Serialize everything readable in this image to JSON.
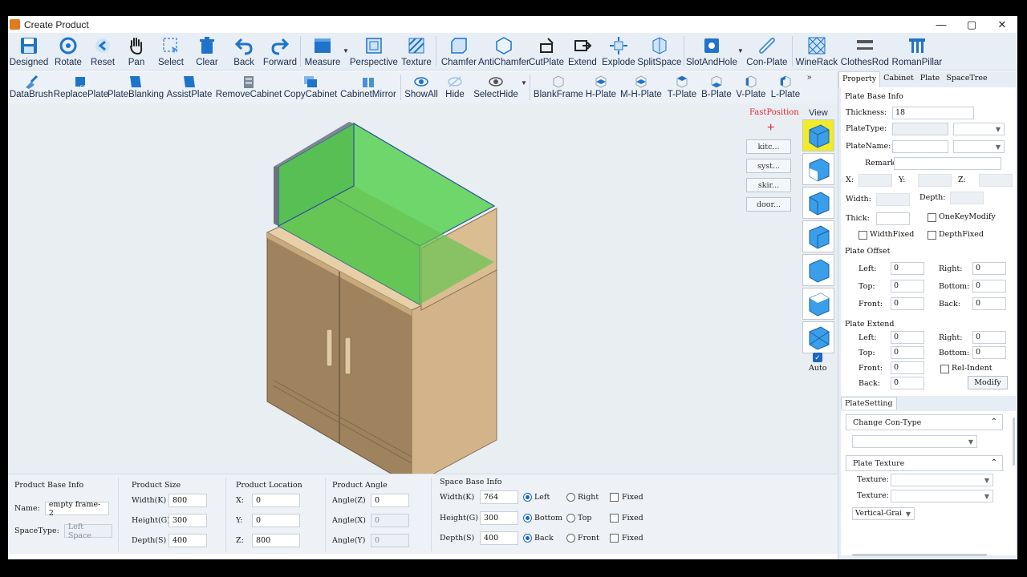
{
  "window": {
    "title": "Create Product",
    "controls": [
      "—",
      "▢",
      "✕"
    ]
  },
  "toolbar1": [
    {
      "label": "Designed",
      "icon": "save-icon"
    },
    {
      "label": "Rotate",
      "icon": "rotate-icon"
    },
    {
      "label": "Reset",
      "icon": "reset-icon"
    },
    {
      "label": "Pan",
      "icon": "hand-icon"
    },
    {
      "label": "Select",
      "icon": "select-icon"
    },
    {
      "label": "Clear",
      "icon": "trash-icon"
    },
    {
      "label": "Back",
      "icon": "undo-icon"
    },
    {
      "label": "Forward",
      "icon": "redo-icon"
    },
    {
      "label": "Measure",
      "icon": "measure-icon"
    },
    {
      "label": "Perspective",
      "icon": "perspective-icon"
    },
    {
      "label": "Texture",
      "icon": "texture-icon"
    },
    {
      "label": "Chamfer",
      "icon": "chamfer-icon"
    },
    {
      "label": "AntiChamfer",
      "icon": "antichamfer-icon"
    },
    {
      "label": "CutPlate",
      "icon": "cutplate-icon"
    },
    {
      "label": "Extend",
      "icon": "extend-icon"
    },
    {
      "label": "Explode",
      "icon": "explode-icon"
    },
    {
      "label": "SplitSpace",
      "icon": "splitspace-icon"
    },
    {
      "label": "SlotAndHole",
      "icon": "slot-icon"
    },
    {
      "label": "Con-Plate",
      "icon": "link-icon"
    },
    {
      "label": "WineRack",
      "icon": "winerack-icon"
    },
    {
      "label": "ClothesRod",
      "icon": "clothesrod-icon"
    },
    {
      "label": "RomanPillar",
      "icon": "pillar-icon"
    }
  ],
  "toolbar2": [
    {
      "label": "DataBrush",
      "icon": "brush-icon"
    },
    {
      "label": "ReplacePlate",
      "icon": "replace-icon"
    },
    {
      "label": "PlateBlanking",
      "icon": "plate-icon"
    },
    {
      "label": "AssistPlate",
      "icon": "plate-icon"
    },
    {
      "label": "RemoveCabinet",
      "icon": "cabinet-icon"
    },
    {
      "label": "CopyCabinet",
      "icon": "copy-icon"
    },
    {
      "label": "CabinetMirror",
      "icon": "mirror-icon"
    },
    {
      "label": "ShowAll",
      "icon": "eye-icon"
    },
    {
      "label": "Hide",
      "icon": "eye-hide-icon"
    },
    {
      "label": "SelectHide",
      "icon": "eye-select-icon"
    },
    {
      "label": "BlankFrame",
      "icon": "frame-icon"
    },
    {
      "label": "H-Plate",
      "icon": "hplate-icon"
    },
    {
      "label": "M-H-Plate",
      "icon": "mhplate-icon"
    },
    {
      "label": "T-Plate",
      "icon": "tplate-icon"
    },
    {
      "label": "B-Plate",
      "icon": "bplate-icon"
    },
    {
      "label": "V-Plate",
      "icon": "vplate-icon"
    },
    {
      "label": "L-Plate",
      "icon": "lplate-icon"
    }
  ],
  "viewport": {
    "fast_position": "FastPosition",
    "view_label": "View",
    "side_buttons": [
      "kitc...",
      "syst...",
      "skir...",
      "door..."
    ],
    "auto_label": "Auto"
  },
  "bottom": {
    "product_base": {
      "title": "Product Base Info",
      "name_label": "Name:",
      "name_value": "empty frame-2",
      "spacetype_label": "SpaceType:",
      "spacetype_value": "Left Space"
    },
    "product_size": {
      "title": "Product Size",
      "width_label": "Width(K)",
      "width_value": "800",
      "height_label": "Height(G)",
      "height_value": "300",
      "depth_label": "Depth(S)",
      "depth_value": "400"
    },
    "product_location": {
      "title": "Product Location",
      "x_label": "X:",
      "x_value": "0",
      "y_label": "Y:",
      "y_value": "0",
      "z_label": "Z:",
      "z_value": "800"
    },
    "product_angle": {
      "title": "Product Angle",
      "az_label": "Angle(Z)",
      "az_value": "0",
      "ax_label": "Angle(X)",
      "ax_value": "0",
      "ay_label": "Angle(Y)",
      "ay_value": "0"
    },
    "space_base": {
      "title": "Space Base Info",
      "width_label": "Width(K)",
      "width_value": "764",
      "height_label": "Height(G)",
      "height_value": "300",
      "depth_label": "Depth(S)",
      "depth_value": "400",
      "r1a": "Left",
      "r1b": "Right",
      "r2a": "Bottom",
      "r2b": "Top",
      "r3a": "Back",
      "r3b": "Front",
      "fixed": "Fixed"
    }
  },
  "rpanel": {
    "tabs": [
      "Property",
      "Cabinet",
      "Plate",
      "SpaceTree"
    ],
    "plate_base_title": "Plate Base Info",
    "thickness_label": "Thickness:",
    "thickness_value": "18",
    "platetype_label": "PlateType:",
    "platename_label": "PlateName:",
    "remarks_label": "Remarks",
    "x_label": "X:",
    "y_label": "Y:",
    "z_label": "Z:",
    "width_label": "Width:",
    "depth_label": "Depth:",
    "thick_label": "Thick:",
    "onekey_label": "OneKeyModify",
    "widthfixed_label": "WidthFixed",
    "depthfixed_label": "DepthFixed",
    "offset_title": "Plate Offset",
    "extend_title": "Plate Extend",
    "left_label": "Left:",
    "right_label": "Right:",
    "top_label": "Top:",
    "bottom_label": "Bottom:",
    "front_label": "Front:",
    "back_label": "Back:",
    "offset": {
      "left": "0",
      "right": "0",
      "top": "0",
      "bottom": "0",
      "front": "0",
      "back": "0"
    },
    "extend": {
      "left": "0",
      "right": "0",
      "top": "0",
      "bottom": "0",
      "front": "0",
      "back": "0"
    },
    "relindent_label": "Rel-Indent",
    "modify_label": "Modify",
    "plate_setting_tab": "PlateSetting",
    "change_con_type": "Change Con-Type",
    "plate_texture": "Plate Texture",
    "texture_label": "Texture:",
    "grain_value": "Vertical-Grai"
  },
  "colors": {
    "accent": "#1a66c7",
    "green_plate": "#5fd35a",
    "wood": "#b79a72",
    "active_view": "#f2ec28"
  }
}
